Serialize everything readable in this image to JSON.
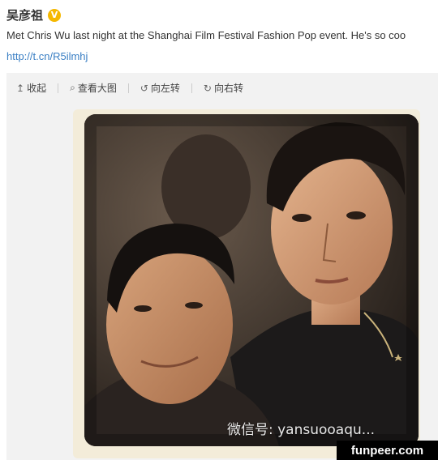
{
  "post": {
    "username": "吴彦祖",
    "verified_badge": "V",
    "text": "Met Chris Wu last night at the Shanghai Film Festival Fashion Pop event. He's so coo",
    "link": "http://t.cn/R5ilmhj"
  },
  "toolbar": {
    "collapse": "收起",
    "view_large": "查看大图",
    "rotate_left": "向左转",
    "rotate_right": "向右转"
  },
  "photo": {
    "watermark": "微信号: yansuooaqu..."
  },
  "site_tag": "funpeer.com"
}
